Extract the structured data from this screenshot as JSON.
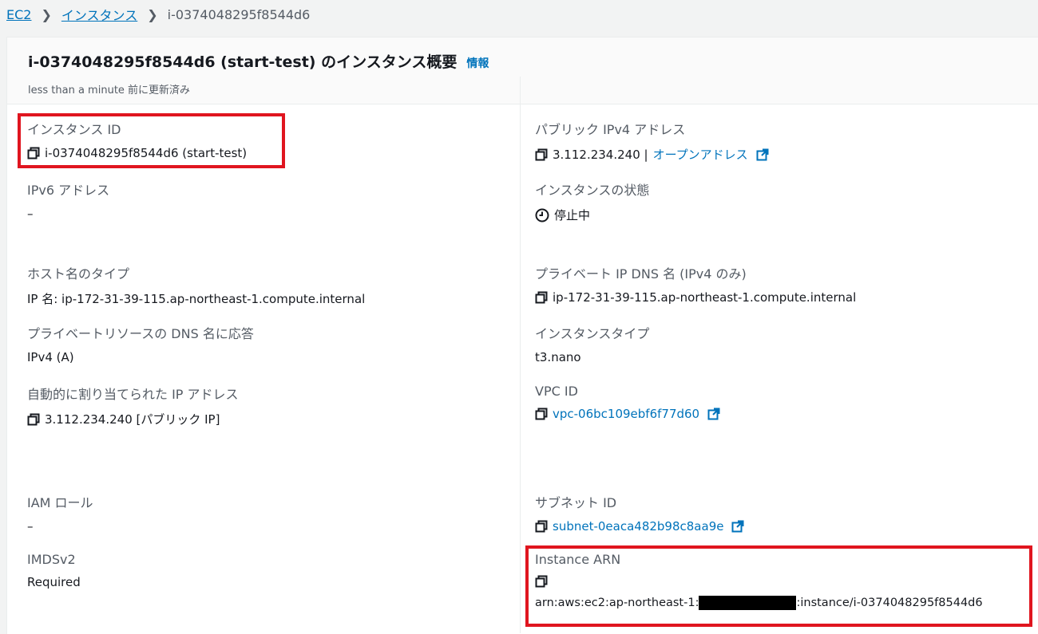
{
  "breadcrumb": {
    "root": "EC2",
    "instances": "インスタンス",
    "current": "i-0374048295f8544d6"
  },
  "header": {
    "title": "i-0374048295f8544d6 (start-test) のインスタンス概要",
    "info": "情報",
    "updated": "less than a minute 前に更新済み"
  },
  "fields": {
    "instance_id": {
      "label": "インスタンス ID",
      "value": "i-0374048295f8544d6 (start-test)"
    },
    "ipv6": {
      "label": "IPv6 アドレス",
      "value": "–"
    },
    "hostname_type": {
      "label": "ホスト名のタイプ",
      "value": "IP 名: ip-172-31-39-115.ap-northeast-1.compute.internal"
    },
    "private_dns_answer": {
      "label": "プライベートリソースの DNS 名に応答",
      "value": "IPv4 (A)"
    },
    "auto_ip": {
      "label": "自動的に割り当てられた IP アドレス",
      "value": "3.112.234.240 [パブリック IP]"
    },
    "iam_role": {
      "label": "IAM ロール",
      "value": "–"
    },
    "imdsv2": {
      "label": "IMDSv2",
      "value": "Required"
    },
    "public_ipv4": {
      "label": "パブリック IPv4 アドレス",
      "value": "3.112.234.240 |",
      "link": "オープンアドレス"
    },
    "instance_state": {
      "label": "インスタンスの状態",
      "value": "停止中"
    },
    "private_dns": {
      "label": "プライベート IP DNS 名 (IPv4 のみ)",
      "value": "ip-172-31-39-115.ap-northeast-1.compute.internal"
    },
    "instance_type": {
      "label": "インスタンスタイプ",
      "value": "t3.nano"
    },
    "vpc_id": {
      "label": "VPC ID",
      "value": "vpc-06bc109ebf6f77d60"
    },
    "subnet_id": {
      "label": "サブネット ID",
      "value": "subnet-0eaca482b98c8aa9e"
    },
    "arn": {
      "label": "Instance ARN",
      "prefix": "arn:aws:ec2:ap-northeast-1:",
      "suffix": ":instance/i-0374048295f8544d6"
    }
  },
  "colors": {
    "link": "#0073bb",
    "highlight": "#e0151f",
    "text": "#16191f",
    "muted": "#545b64"
  },
  "icons": [
    "copy-icon",
    "external-link-icon",
    "clock-icon",
    "chevron-right-icon"
  ]
}
